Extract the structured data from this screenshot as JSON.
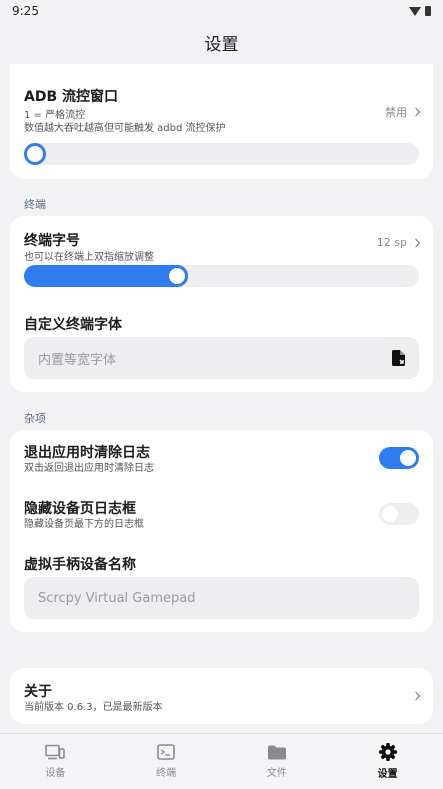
{
  "status": {
    "time": "9:25"
  },
  "header": {
    "title": "设置"
  },
  "adb": {
    "title": "ADB 流控窗口",
    "sub1": "1 = 严格流控",
    "sub2": "数值越大吞吐越高但可能触发 adbd 流控保护",
    "value": "禁用",
    "slider_fraction": 0.0
  },
  "sections": {
    "terminal": "终端",
    "misc": "杂项"
  },
  "terminal": {
    "font_size_title": "终端字号",
    "font_size_sub": "也可以在终端上双指缩放调整",
    "font_size_value": "12 sp",
    "slider_fraction": 0.38,
    "custom_font_title": "自定义终端字体",
    "custom_font_placeholder": "内置等宽字体"
  },
  "misc": {
    "clear_log_title": "退出应用时清除日志",
    "clear_log_sub": "双击返回退出应用时清除日志",
    "clear_log_on": true,
    "hide_log_title": "隐藏设备页日志框",
    "hide_log_sub": "隐藏设备页最下方的日志框",
    "hide_log_on": false,
    "gamepad_title": "虚拟手柄设备名称",
    "gamepad_placeholder": "Scrcpy Virtual Gamepad"
  },
  "about": {
    "title": "关于",
    "sub": "当前版本 0.6.3，已是最新版本"
  },
  "nav": {
    "items": [
      {
        "label": "设备",
        "icon": "device-icon"
      },
      {
        "label": "终端",
        "icon": "terminal-icon"
      },
      {
        "label": "文件",
        "icon": "folder-icon"
      },
      {
        "label": "设置",
        "icon": "gear-icon"
      }
    ]
  },
  "colors": {
    "accent": "#2f7bf0",
    "background": "#f2f2f5",
    "card": "#ffffff"
  }
}
